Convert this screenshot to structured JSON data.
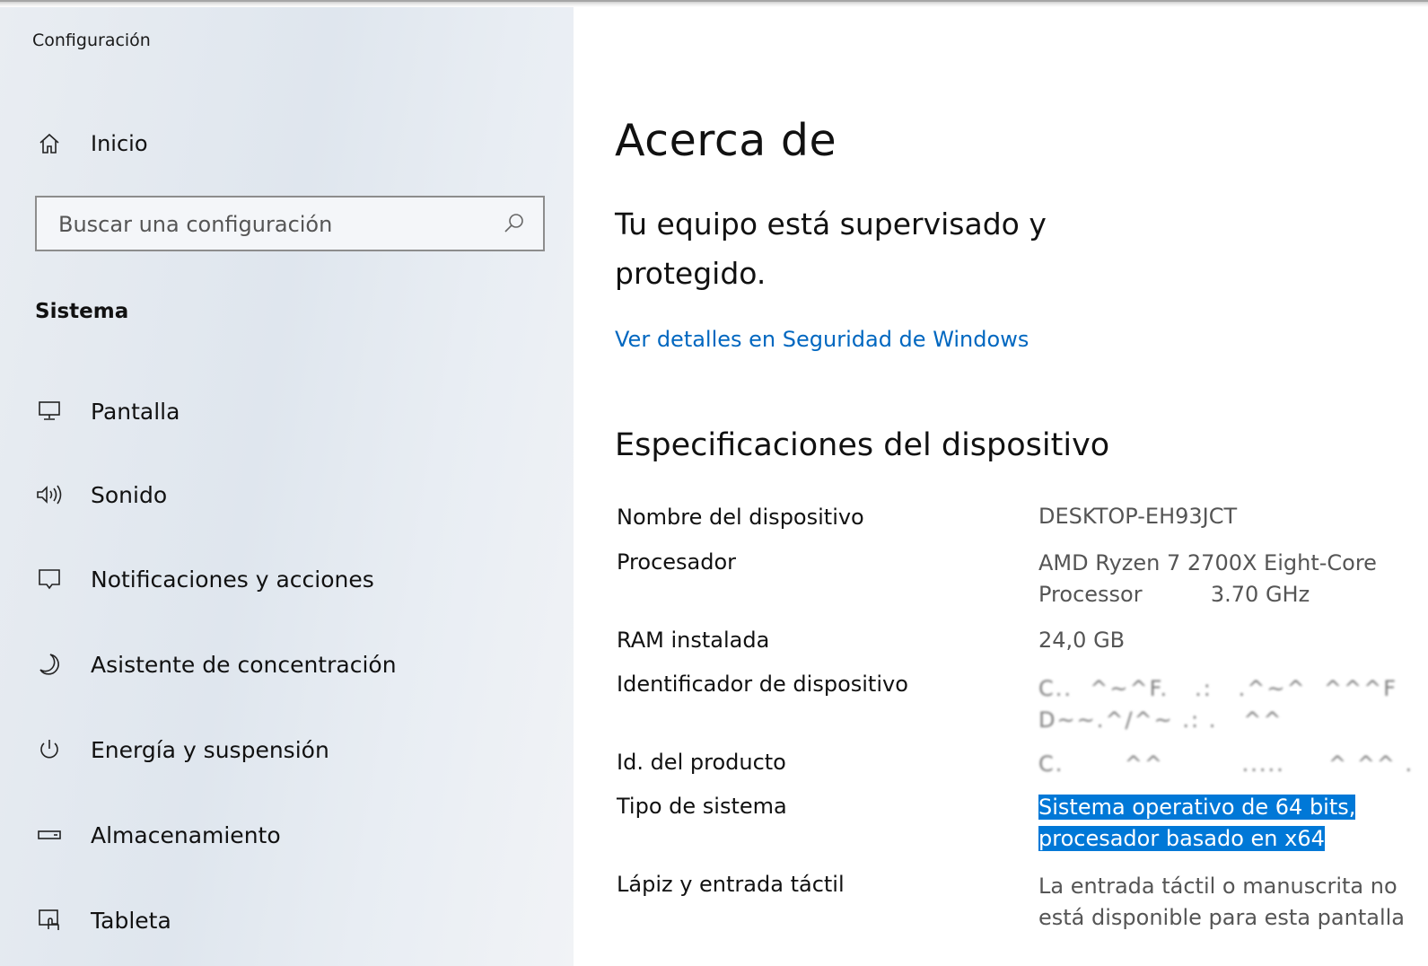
{
  "window": {
    "title": "Configuración"
  },
  "sidebar": {
    "home_label": "Inicio",
    "search_placeholder": "Buscar una configuración",
    "section_title": "Sistema",
    "items": [
      {
        "label": "Pantalla",
        "icon": "monitor-icon"
      },
      {
        "label": "Sonido",
        "icon": "speaker-icon"
      },
      {
        "label": "Notificaciones y acciones",
        "icon": "notification-icon"
      },
      {
        "label": "Asistente de concentración",
        "icon": "moon-icon"
      },
      {
        "label": "Energía y suspensión",
        "icon": "power-icon"
      },
      {
        "label": "Almacenamiento",
        "icon": "storage-icon"
      },
      {
        "label": "Tableta",
        "icon": "tablet-icon"
      }
    ]
  },
  "main": {
    "title": "Acerca de",
    "status_line1": "Tu equipo está supervisado y",
    "status_line2": "protegido.",
    "security_link": "Ver detalles en Seguridad de Windows",
    "specs_title": "Especificaciones del dispositivo",
    "specs": {
      "device_name": {
        "label": "Nombre del dispositivo",
        "value": "DESKTOP-EH93JCT"
      },
      "processor": {
        "label": "Procesador",
        "value_line1": "AMD Ryzen 7 2700X Eight-Core",
        "value_line2": "Processor          3.70 GHz"
      },
      "ram": {
        "label": "RAM instalada",
        "value": "24,0 GB"
      },
      "device_id": {
        "label": "Identificador de dispositivo",
        "value_line1": "C..  ^~^F.   .:   .^~^  ^^^F",
        "value_line2": "D~~.^/^~ .: .   ^^"
      },
      "product_id": {
        "label": "Id. del producto",
        "value": "C.       ^^         .....     ^ ^^ ."
      },
      "system_type": {
        "label": "Tipo de sistema",
        "value_line1": "Sistema operativo de 64 bits,",
        "value_line2": "procesador basado en x64"
      },
      "pen_touch": {
        "label": "Lápiz y entrada táctil",
        "value_line1": "La entrada táctil o manuscrita no",
        "value_line2": "está disponible para esta pantalla"
      }
    }
  },
  "colors": {
    "link": "#0067c0",
    "selection": "#0078d7",
    "sidebar_bg": "#e4e9ef"
  }
}
